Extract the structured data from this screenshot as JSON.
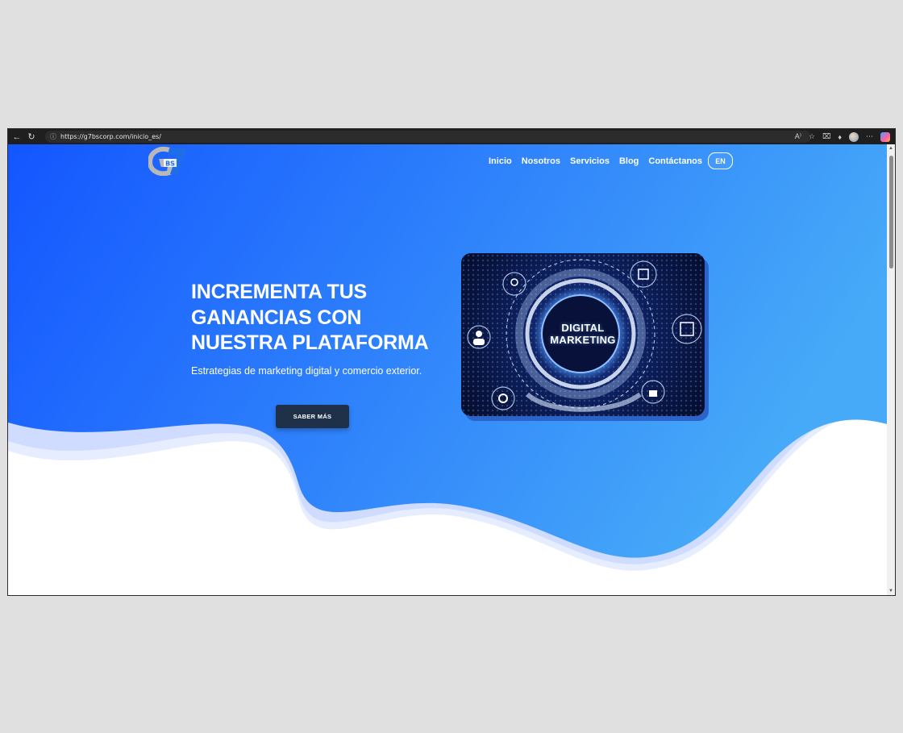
{
  "browser": {
    "url": "https://g7bscorp.com/inicio_es/",
    "back_icon": "back-arrow-icon",
    "reload_icon": "reload-icon"
  },
  "site": {
    "logo_text": "G7 BS",
    "nav": [
      "Inicio",
      "Nosotros",
      "Servicios",
      "Blog",
      "Contáctanos"
    ],
    "lang_button": "EN"
  },
  "hero": {
    "title_lines": [
      "INCREMENTA TUS",
      "GANANCIAS CON",
      "NUESTRA PLATAFORMA"
    ],
    "subtitle": "Estrategias de marketing digital y comercio exterior.",
    "cta_label": "SABER MÁS",
    "image_text_lines": [
      "DIGITAL",
      "MARKETING"
    ]
  },
  "colors": {
    "hero_gradient_start": "#1456ff",
    "hero_gradient_end": "#47aaf8",
    "cta_bg": "#1f3149",
    "chrome_bg": "#1f1f1f"
  }
}
